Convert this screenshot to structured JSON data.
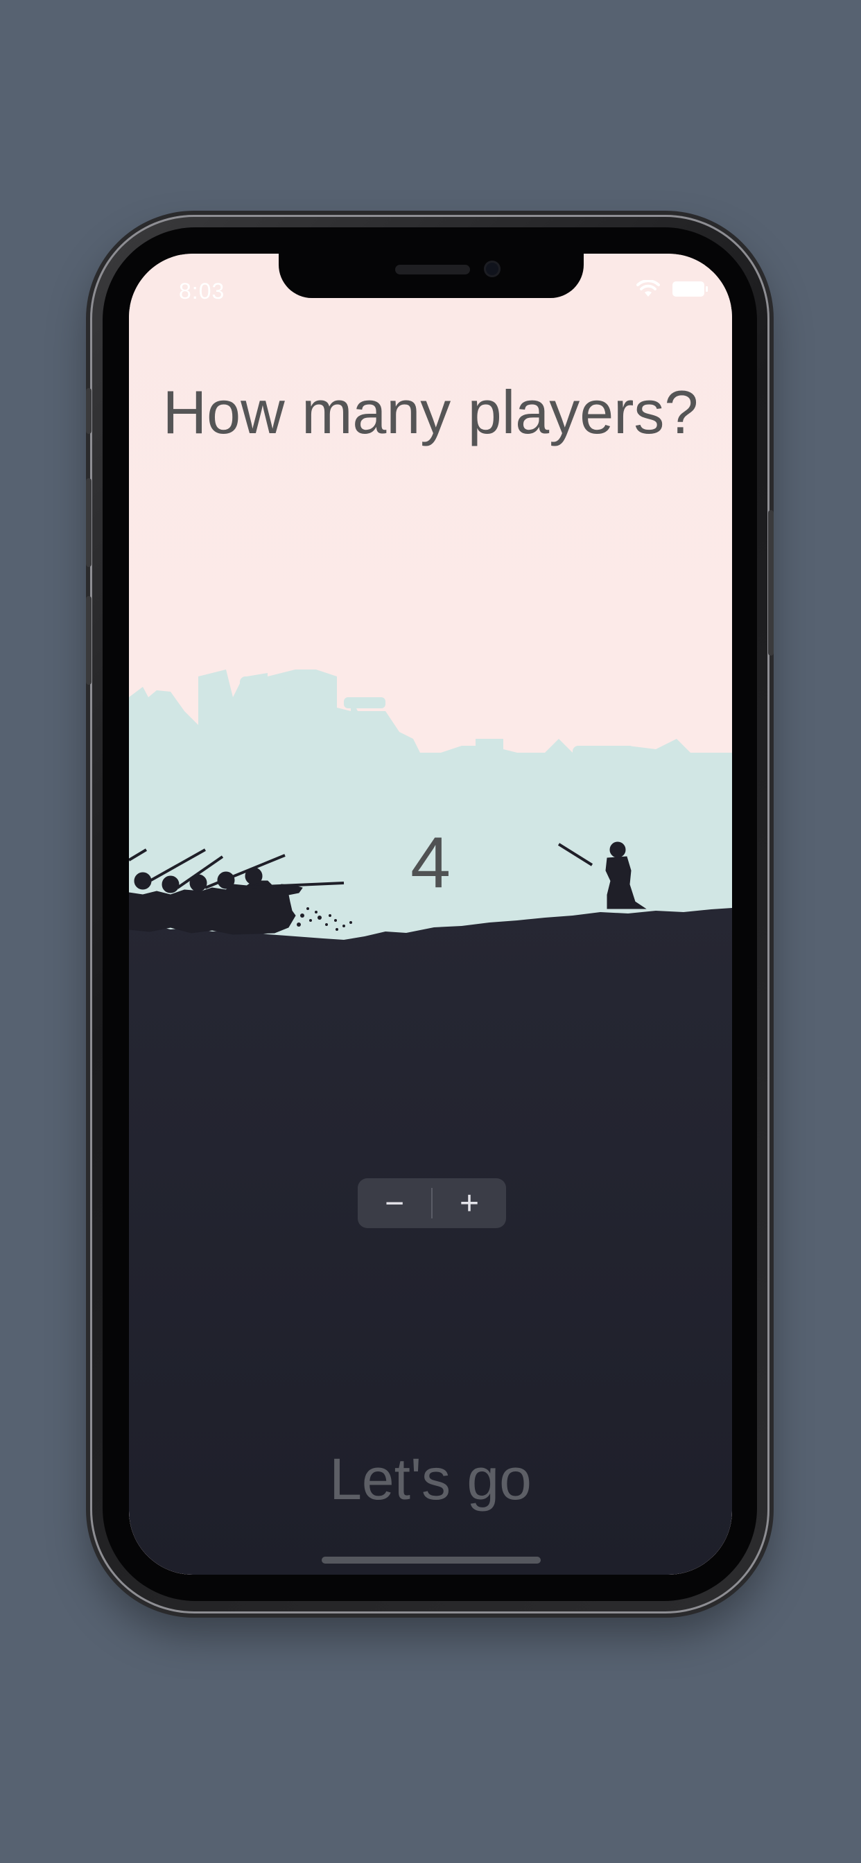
{
  "status_bar": {
    "time": "8:03",
    "wifi_icon": "wifi-icon",
    "battery_icon": "battery-icon"
  },
  "setup": {
    "title": "How many players?",
    "player_count": "4",
    "decrement_label": "−",
    "increment_label": "+",
    "start_label": "Let's go"
  },
  "colors": {
    "background": "#576271",
    "sky": "#fbe9e7",
    "ground": "#22232f",
    "castle": "#c9e4e3"
  }
}
